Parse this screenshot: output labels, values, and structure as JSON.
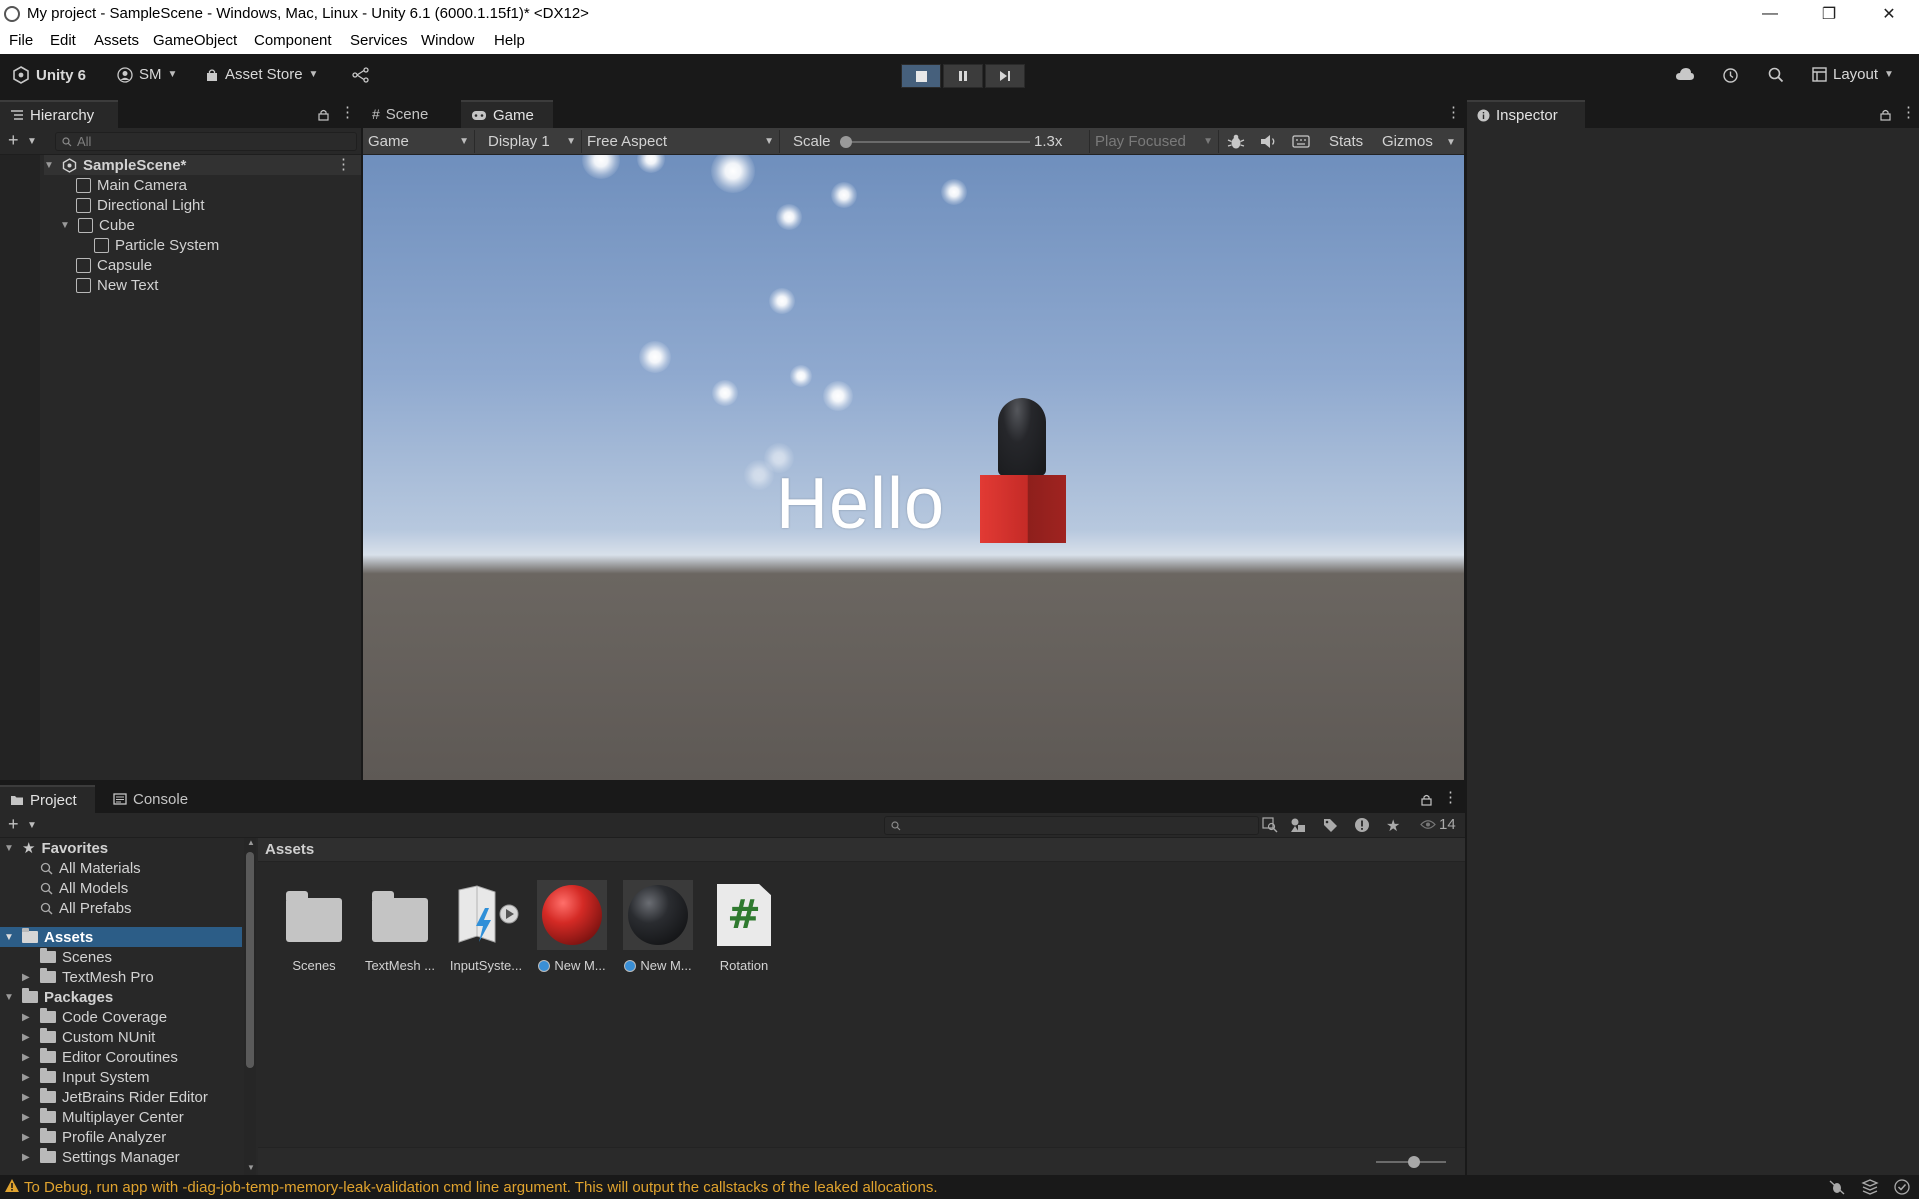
{
  "window": {
    "title": "My project - SampleScene - Windows, Mac, Linux - Unity 6.1 (6000.1.15f1)* <DX12>",
    "controls": {
      "minimize": "—",
      "maximize": "❐",
      "close": "✕"
    }
  },
  "menu": [
    "File",
    "Edit",
    "Assets",
    "GameObject",
    "Component",
    "Services",
    "Window",
    "Help"
  ],
  "toolbar": {
    "brand": "Unity 6",
    "account": "SM",
    "asset_store": "Asset Store",
    "layout": "Layout",
    "play_state": "playing"
  },
  "hierarchy": {
    "tab": "Hierarchy",
    "search_placeholder": "All",
    "scene": "SampleScene*",
    "items": [
      {
        "label": "Main Camera"
      },
      {
        "label": "Directional Light"
      },
      {
        "label": "Cube"
      },
      {
        "label": "Particle System"
      },
      {
        "label": "Capsule"
      },
      {
        "label": "New Text"
      }
    ]
  },
  "center_tabs": {
    "scene": "Scene",
    "game": "Game"
  },
  "game_toolbar": {
    "view": "Game",
    "display": "Display 1",
    "aspect": "Free Aspect",
    "scale_label": "Scale",
    "scale_value": "1.3x",
    "scale_fraction": 0.0,
    "play_focused": "Play Focused",
    "stats": "Stats",
    "gizmos": "Gizmos"
  },
  "game_view": {
    "text": "Hello",
    "colors": {
      "cube": "#d63232",
      "capsule": "#1c1c1f"
    }
  },
  "inspector": {
    "tab": "Inspector"
  },
  "bottom_tabs": {
    "project": "Project",
    "console": "Console"
  },
  "project": {
    "favorites": {
      "label": "Favorites",
      "items": [
        "All Materials",
        "All Models",
        "All Prefabs"
      ]
    },
    "assets_folder": {
      "label": "Assets",
      "items": [
        "Scenes",
        "TextMesh Pro"
      ]
    },
    "packages": {
      "label": "Packages",
      "items": [
        "Code Coverage",
        "Custom NUnit",
        "Editor Coroutines",
        "Input System",
        "JetBrains Rider Editor",
        "Multiplayer Center",
        "Profile Analyzer",
        "Settings Manager"
      ]
    },
    "breadcrumb": "Assets",
    "visible_count": "14",
    "assets": [
      {
        "label": "Scenes",
        "kind": "folder"
      },
      {
        "label": "TextMesh ...",
        "kind": "folder"
      },
      {
        "label": "InputSyste...",
        "kind": "input-actions"
      },
      {
        "label": "New M...",
        "kind": "material-red"
      },
      {
        "label": "New M...",
        "kind": "material-dark"
      },
      {
        "label": "Rotation",
        "kind": "script"
      }
    ]
  },
  "status": {
    "message": "To Debug, run app with -diag-job-temp-memory-leak-validation cmd line argument. This will output the callstacks of the leaked allocations.",
    "color": "#e0a32e"
  }
}
